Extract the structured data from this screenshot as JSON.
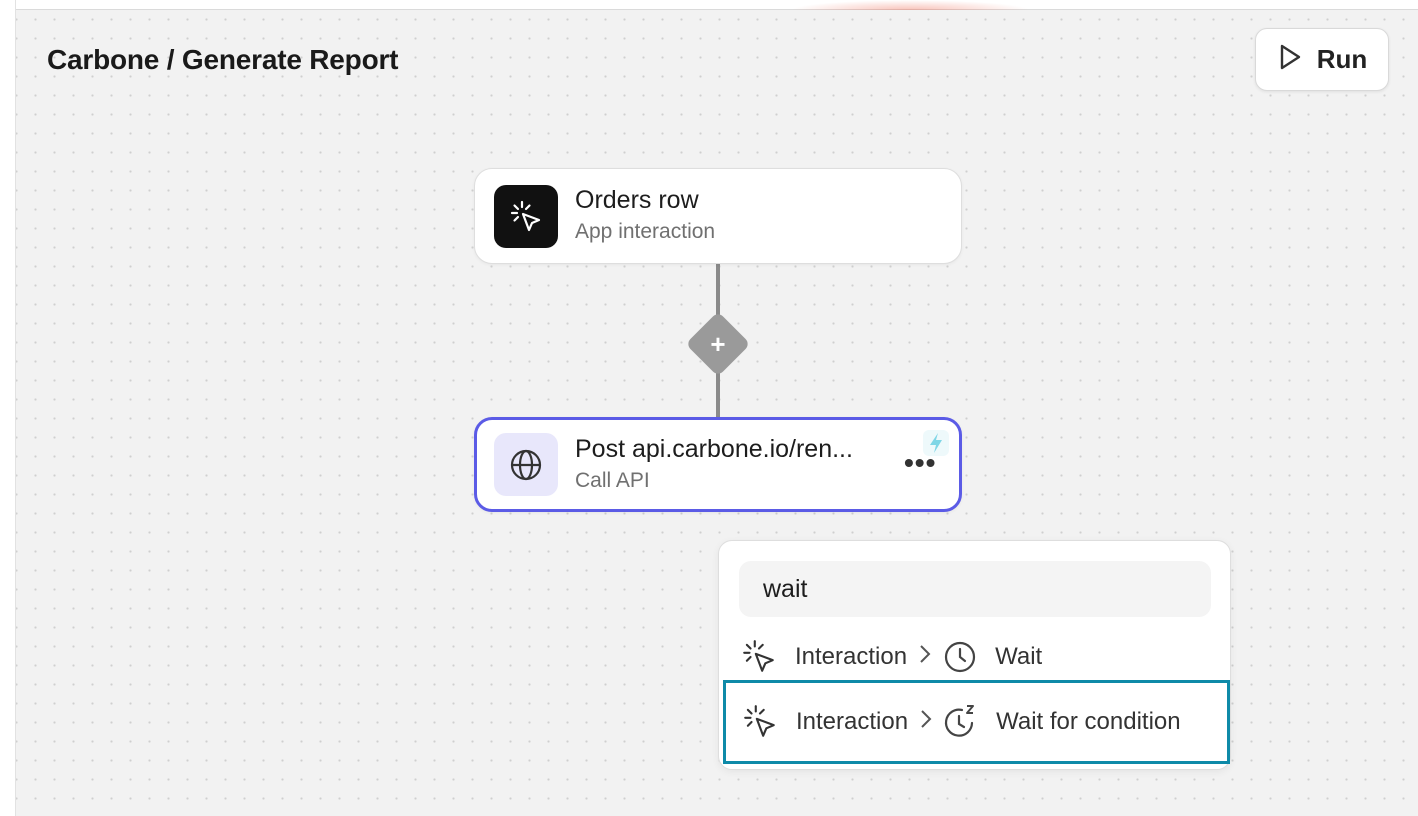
{
  "header": {
    "title": "Carbone / Generate Report",
    "run_label": "Run"
  },
  "workflow": {
    "nodes": [
      {
        "title": "Orders row",
        "subtitle": "App interaction",
        "icon": "cursor-click-icon"
      },
      {
        "title": "Post api.carbone.io/ren...",
        "subtitle": "Call API",
        "icon": "globe-icon",
        "selected": true
      }
    ],
    "add_step_symbol": "+"
  },
  "step_picker": {
    "search_value": "wait",
    "results": [
      {
        "category": "Interaction",
        "name": "Wait",
        "icon": "clock-icon"
      },
      {
        "category": "Interaction",
        "name": "Wait for condition",
        "icon": "clock-snooze-icon",
        "highlighted": true
      }
    ]
  },
  "colors": {
    "selected_node_border": "#5b5be6",
    "highlight_border": "#0e8aa8",
    "connector": "#8a8a8a"
  }
}
